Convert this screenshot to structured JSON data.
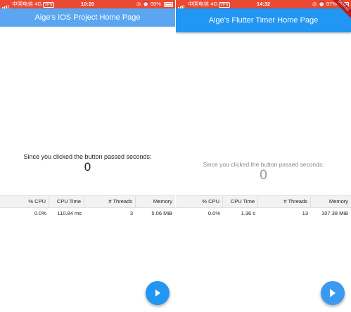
{
  "left": {
    "status": {
      "carrier": "中国电信",
      "network": "4G",
      "vpn": "VPN",
      "time": "10:20",
      "battery": "95%"
    },
    "app_title": "Aige's IOS Project Home Page",
    "caption": "Since you clicked the button passed seconds:",
    "counter": "0",
    "perf_headers": [
      "% CPU",
      "CPU Time",
      "# Threads",
      "Memory"
    ],
    "perf_values": [
      "0.0%",
      "110.84 ms",
      "3",
      "5.06 MiB"
    ],
    "fab_icon": "play-icon"
  },
  "right": {
    "status": {
      "carrier": "中国电信",
      "network": "4G",
      "vpn": "VPN",
      "time": "14:32",
      "battery": "97%"
    },
    "app_title": "Aige's Flutter Timer Home Page",
    "debug_banner": "DEBUG",
    "caption": "Since you clicked the button passed seconds:",
    "counter": "0",
    "perf_headers": [
      "% CPU",
      "CPU Time",
      "# Threads",
      "Memory"
    ],
    "perf_values": [
      "0.0%",
      "1.36 s",
      "13",
      "107.38 MiB"
    ],
    "fab_icon": "play-icon"
  },
  "colors": {
    "status_bar": "#ea4a34",
    "appbar_left": "#5aa6f0",
    "appbar_right": "#2196f3",
    "fab": "#2196f3"
  }
}
